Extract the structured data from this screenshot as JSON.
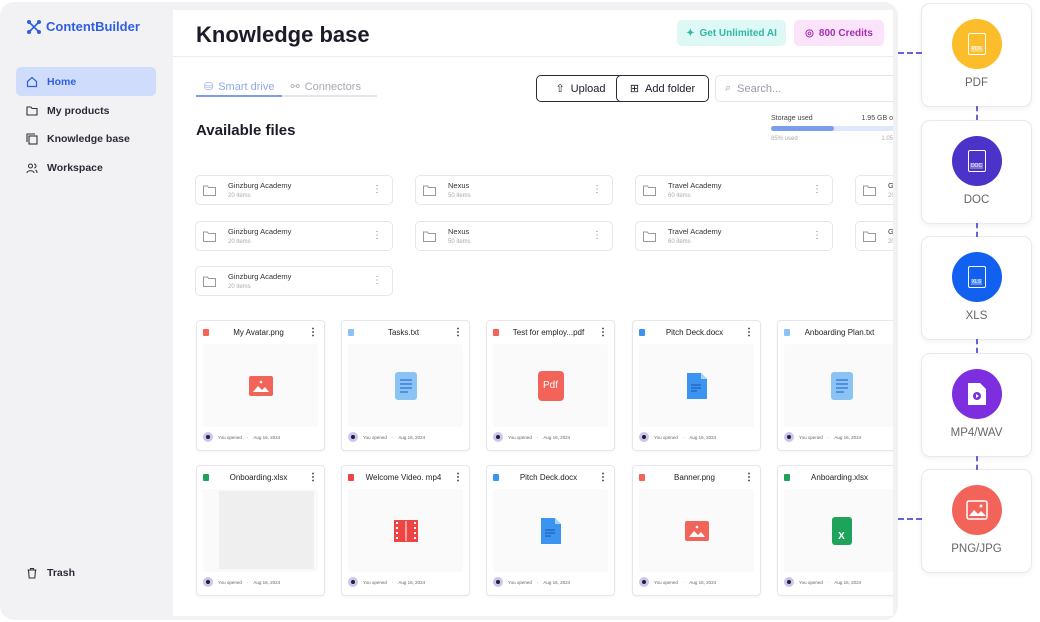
{
  "app": {
    "name": "ContentBuilder"
  },
  "sidebar": {
    "items": [
      {
        "label": "Home",
        "icon": "home-icon",
        "active": true
      },
      {
        "label": "My products",
        "icon": "folder-open-icon"
      },
      {
        "label": "Knowledge base",
        "icon": "copy-icon"
      },
      {
        "label": "Workspace",
        "icon": "users-icon"
      }
    ],
    "trash": "Trash"
  },
  "header": {
    "title": "Knowledge base",
    "unlimited": "Get Unlimited AI",
    "credits": "800 Credits"
  },
  "tabs": [
    {
      "label": "Smart drive",
      "active": true
    },
    {
      "label": "Connectors"
    }
  ],
  "toolbar": {
    "upload": "Upload",
    "add_folder": "Add folder",
    "search_placeholder": "Search..."
  },
  "section_title": "Available files",
  "storage": {
    "label": "Storage used",
    "value": "1.95 GB o",
    "used_label": "85% used",
    "right": "1.05",
    "percent": 45
  },
  "folders": [
    {
      "name": "Ginzburg Academy",
      "count": "20 items"
    },
    {
      "name": "Nexus",
      "count": "50 items"
    },
    {
      "name": "Travel Academy",
      "count": "60 items"
    },
    {
      "name": "Gin",
      "count": "20 it"
    },
    {
      "name": "Ginzburg Academy",
      "count": "20 items"
    },
    {
      "name": "Nexus",
      "count": "50 items"
    },
    {
      "name": "Travel Academy",
      "count": "60 items"
    },
    {
      "name": "Gin",
      "count": "20 it"
    },
    {
      "name": "Ginzburg Academy",
      "count": "20 items"
    }
  ],
  "files": [
    {
      "name": "My Avatar.png",
      "type": "image",
      "opened": "You opened",
      "date": "Aug 16, 2024"
    },
    {
      "name": "Tasks.txt",
      "type": "txt",
      "opened": "You opened",
      "date": "Aug 16, 2024"
    },
    {
      "name": "Test for employ...pdf",
      "type": "pdf",
      "opened": "You opened",
      "date": "Aug 16, 2024",
      "icon_text": "Pdf"
    },
    {
      "name": "Pitch Deck.docx",
      "type": "doc",
      "opened": "You opened",
      "date": "Aug 16, 2024"
    },
    {
      "name": "Anboarding Plan.txt",
      "type": "txt",
      "opened": "You opened",
      "date": "Aug 16, 2024"
    },
    {
      "name": "Onboarding.xlsx",
      "type": "xls-preview",
      "opened": "You opened",
      "date": "Aug 16, 2024"
    },
    {
      "name": "Welcome Video. mp4",
      "type": "video",
      "opened": "You opened",
      "date": "Aug 16, 2024"
    },
    {
      "name": "Pitch Deck.docx",
      "type": "doc",
      "opened": "You opened",
      "date": "Aug 16, 2024"
    },
    {
      "name": "Banner.png",
      "type": "image",
      "opened": "You opened",
      "date": "Aug 16, 2024"
    },
    {
      "name": "Anboarding.xlsx",
      "type": "xls",
      "opened": "You opened",
      "date": "Aug 16, 2024",
      "icon_text": "X"
    }
  ],
  "file_types": [
    {
      "label": "PDF",
      "color": "#fbbd2a",
      "badge": "PDF"
    },
    {
      "label": "DOC",
      "color": "#4b32c8",
      "badge": "DOC"
    },
    {
      "label": "XLS",
      "color": "#1260f0",
      "badge": "XLS"
    },
    {
      "label": "MP4/WAV",
      "color": "#7d2fe0"
    },
    {
      "label": "PNG/JPG",
      "color": "#f2645a"
    }
  ],
  "colors": {
    "accent": "#2f5fe0",
    "connector": "#6464d8"
  }
}
